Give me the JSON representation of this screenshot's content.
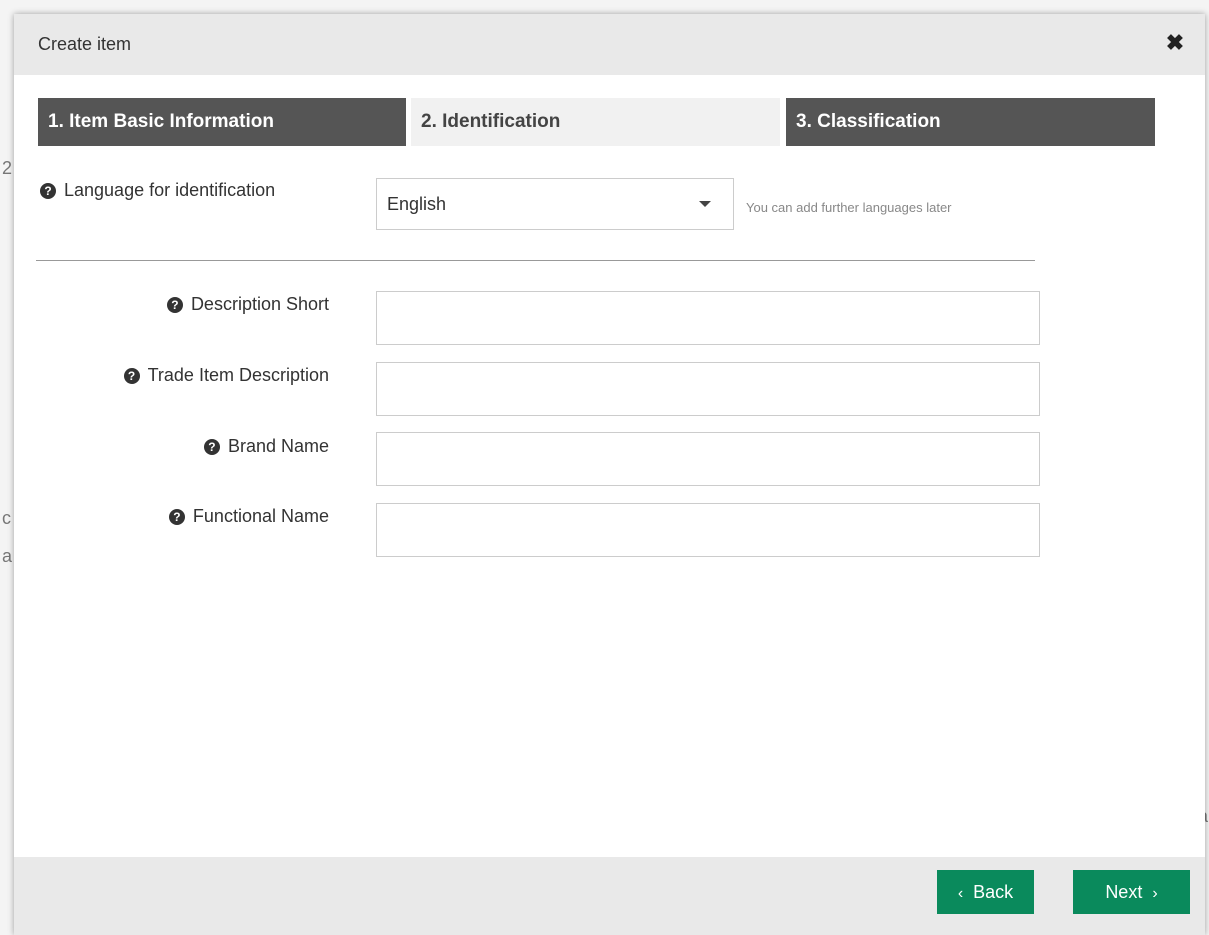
{
  "modal": {
    "title": "Create item",
    "close_symbol": "✖"
  },
  "steps": [
    {
      "label": "1. Item Basic Information",
      "state": "dark"
    },
    {
      "label": "2. Identification",
      "state": "active"
    },
    {
      "label": "3. Classification",
      "state": "dark"
    }
  ],
  "form": {
    "language": {
      "label": "Language for identification",
      "value": "English",
      "hint": "You can add further languages later"
    },
    "fields": [
      {
        "label": "Description Short",
        "value": ""
      },
      {
        "label": "Trade Item Description",
        "value": ""
      },
      {
        "label": "Brand Name",
        "value": ""
      },
      {
        "label": "Functional Name",
        "value": ""
      }
    ]
  },
  "footer": {
    "back_label": "Back",
    "back_chevron": "‹",
    "next_label": "Next",
    "next_chevron": "›"
  },
  "icons": {
    "help": "question-circle-icon",
    "close": "close-icon",
    "caret": "caret-down-icon"
  },
  "colors": {
    "primary_button": "#0a8a5c",
    "step_dark": "#555555",
    "step_active": "#f1f1f1",
    "header_bg": "#e9e9e9"
  }
}
